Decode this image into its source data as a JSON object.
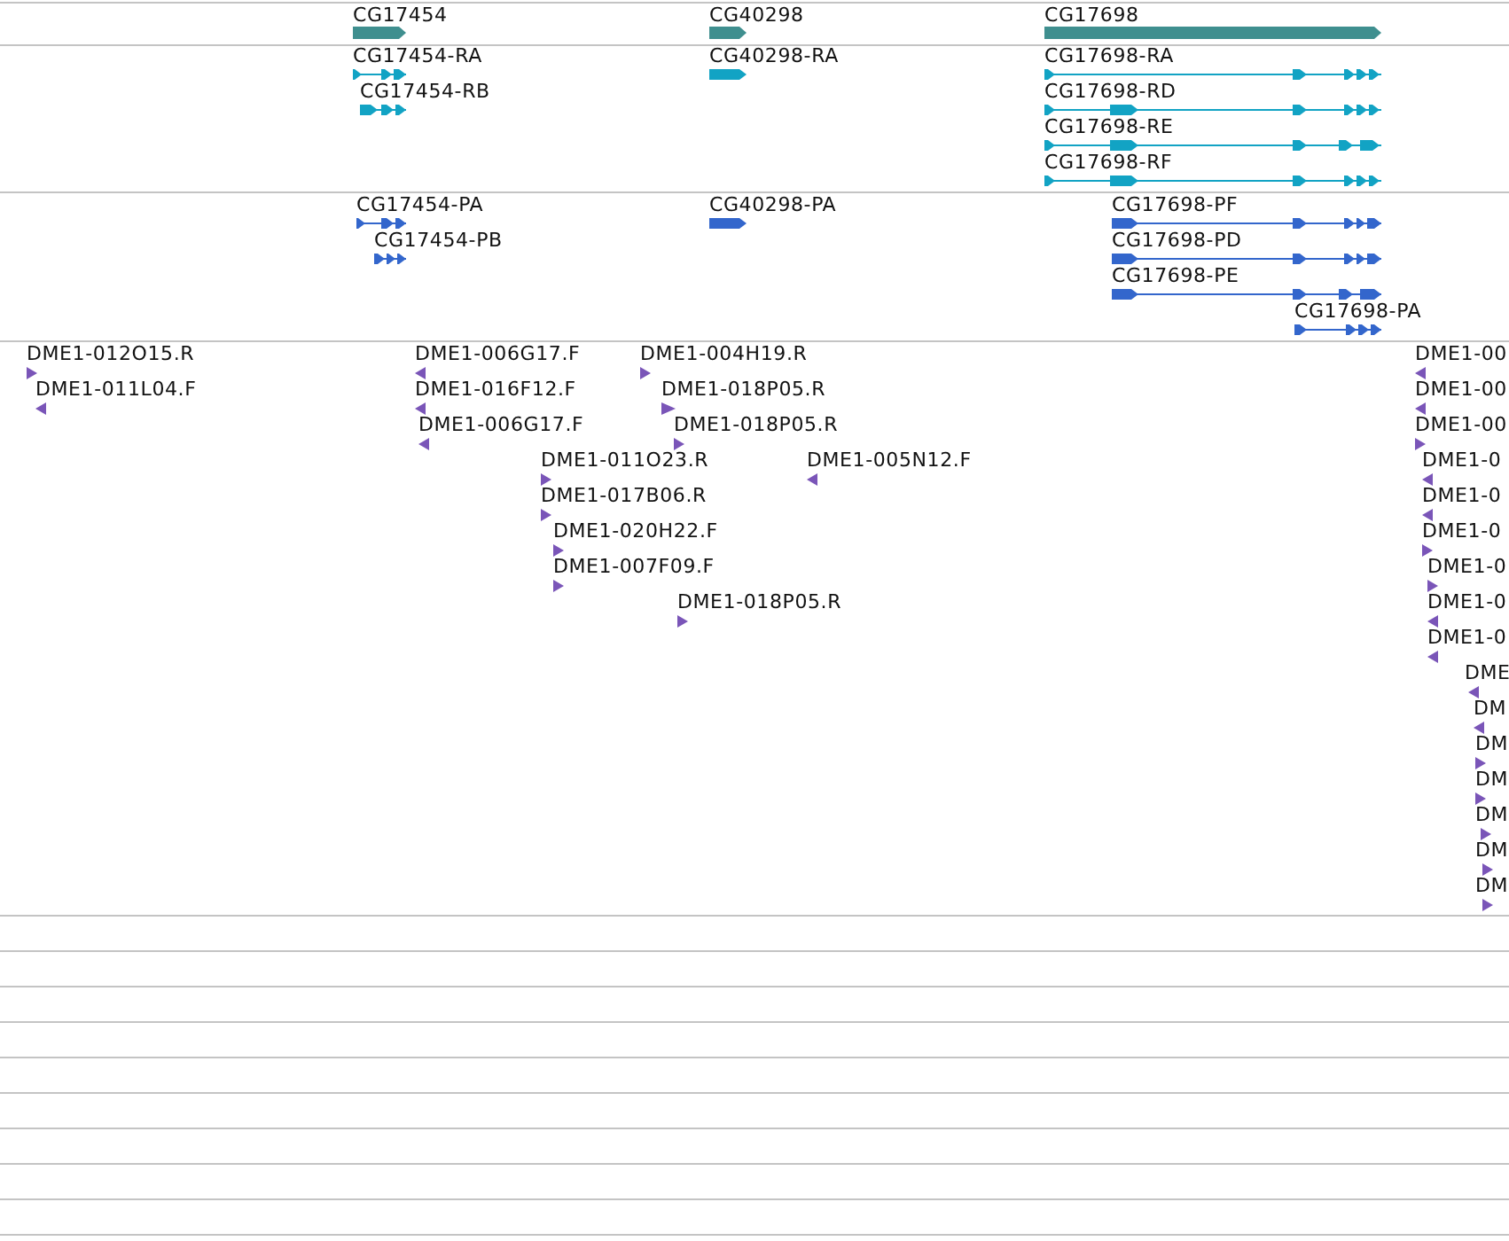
{
  "tracks": [
    {
      "kind": "gene",
      "features": [
        {
          "label": "CG17454",
          "reverse": false
        },
        {
          "label": "CG40298",
          "reverse": false
        },
        {
          "label": "CG17698",
          "reverse": false
        }
      ]
    },
    {
      "kind": "transcript",
      "features": [
        {
          "label": "CG17454-RA",
          "reverse": false
        },
        {
          "label": "CG17454-RB",
          "reverse": false
        },
        {
          "label": "CG40298-RA",
          "reverse": false
        },
        {
          "label": "CG17698-RA",
          "reverse": false
        },
        {
          "label": "CG17698-RD",
          "reverse": false
        },
        {
          "label": "CG17698-RE",
          "reverse": false
        },
        {
          "label": "CG17698-RF",
          "reverse": false
        }
      ]
    },
    {
      "kind": "protein",
      "features": [
        {
          "label": "CG17454-PA",
          "reverse": false
        },
        {
          "label": "CG17454-PB",
          "reverse": false
        },
        {
          "label": "CG40298-PA",
          "reverse": false
        },
        {
          "label": "CG17698-PF",
          "reverse": false
        },
        {
          "label": "CG17698-PD",
          "reverse": false
        },
        {
          "label": "CG17698-PE",
          "reverse": false
        },
        {
          "label": "CG17698-PA",
          "reverse": false
        }
      ]
    },
    {
      "kind": "est",
      "features": [
        {
          "label": "DME1-012O15.R",
          "reverse": false
        },
        {
          "label": "DME1-011L04.F",
          "reverse": true
        },
        {
          "label": "DME1-006G17.F",
          "reverse": true
        },
        {
          "label": "DME1-016F12.F",
          "reverse": true
        },
        {
          "label": "DME1-006G17.F",
          "reverse": true
        },
        {
          "label": "DME1-004H19.R",
          "reverse": false
        },
        {
          "label": "DME1-018P05.R",
          "reverse": false
        },
        {
          "label": "DME1-018P05.R",
          "reverse": false
        },
        {
          "label": "DME1-011O23.R",
          "reverse": false
        },
        {
          "label": "DME1-017B06.R",
          "reverse": false
        },
        {
          "label": "DME1-020H22.F",
          "reverse": false
        },
        {
          "label": "DME1-007F09.F",
          "reverse": false
        },
        {
          "label": "DME1-018P05.R",
          "reverse": false
        },
        {
          "label": "DME1-005N12.F",
          "reverse": true
        },
        {
          "label": "DME1-00",
          "reverse": true
        },
        {
          "label": "DME1-00",
          "reverse": true
        },
        {
          "label": "DME1-00",
          "reverse": false
        },
        {
          "label": "DME1-0",
          "reverse": true
        },
        {
          "label": "DME1-0",
          "reverse": true
        },
        {
          "label": "DME1-0",
          "reverse": false
        },
        {
          "label": "DME1-0",
          "reverse": false
        },
        {
          "label": "DME1-0",
          "reverse": true
        },
        {
          "label": "DME1-0",
          "reverse": true
        },
        {
          "label": "DME",
          "reverse": true
        },
        {
          "label": "DM",
          "reverse": true
        },
        {
          "label": "DM",
          "reverse": false
        },
        {
          "label": "DM",
          "reverse": false
        },
        {
          "label": "DM",
          "reverse": false
        },
        {
          "label": "DM",
          "reverse": false
        },
        {
          "label": "DM",
          "reverse": false
        }
      ]
    }
  ]
}
